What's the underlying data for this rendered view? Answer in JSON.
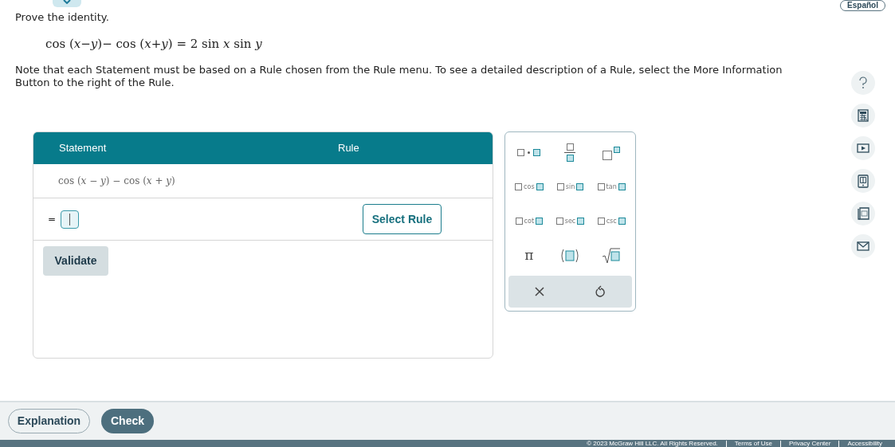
{
  "language_button": "Español",
  "prompt": "Prove the identity.",
  "equation": "cos (*x*−*y*)− cos (*x*+*y*) = 2 sin *x* sin *y*",
  "note": "Note that each Statement must be based on a Rule chosen from the Rule menu. To see a detailed description of a Rule, select the More Information Button to the right of the Rule.",
  "proof_table": {
    "columns": [
      "Statement",
      "Rule"
    ],
    "rows": [
      {
        "kind": "given",
        "statement": "cos (*x* − *y*) − cos (*x* + *y*)"
      },
      {
        "kind": "entry",
        "prefix": "=",
        "rule_button": "Select Rule"
      }
    ],
    "validate_button": "Validate"
  },
  "keypad": {
    "keys": [
      {
        "kind": "product"
      },
      {
        "kind": "fraction"
      },
      {
        "kind": "power"
      },
      {
        "kind": "func",
        "label": "cos"
      },
      {
        "kind": "func",
        "label": "sin"
      },
      {
        "kind": "func",
        "label": "tan"
      },
      {
        "kind": "func",
        "label": "cot"
      },
      {
        "kind": "func",
        "label": "sec"
      },
      {
        "kind": "func",
        "label": "csc"
      },
      {
        "kind": "symbol",
        "label": "π"
      },
      {
        "kind": "paren"
      },
      {
        "kind": "sqrt"
      }
    ]
  },
  "bottom_buttons": [
    {
      "kind": "outline",
      "label": "Explanation"
    },
    {
      "kind": "filled",
      "label": "Check"
    }
  ],
  "footer": [
    "© 2023 McGraw Hill LLC. All Rights Reserved.",
    "Terms of Use",
    "Privacy Center",
    "Accessibility"
  ]
}
